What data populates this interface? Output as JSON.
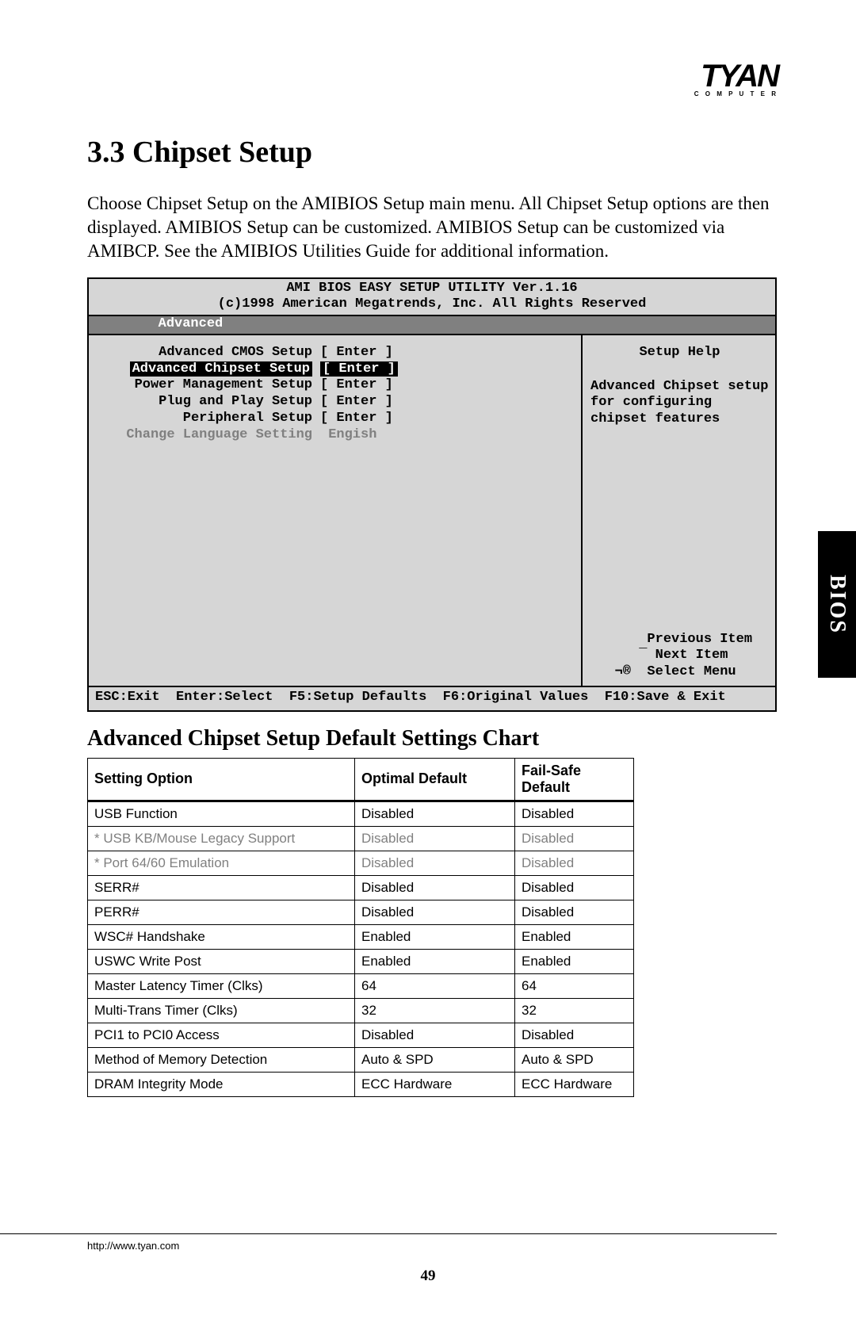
{
  "logo": {
    "brand": "TYAN",
    "subtitle": "C O M P U T E R"
  },
  "section": {
    "heading": "3.3 Chipset Setup",
    "intro": "Choose Chipset Setup on the AMIBIOS Setup main menu. All Chipset Setup options are then displayed. AMIBIOS Setup can be customized. AMIBIOS Setup can be customized via AMIBCP. See the AMIBIOS Utilities Guide for additional information."
  },
  "bios": {
    "title": "AMI BIOS EASY SETUP UTILITY Ver.1.16",
    "copyright": "(c)1998 American Megatrends, Inc.  All Rights Reserved",
    "tab": "Advanced",
    "menu": [
      {
        "label": "Advanced CMOS Setup",
        "value": "[ Enter ]",
        "highlight": false
      },
      {
        "label": "Advanced Chipset Setup",
        "value": "[ Enter ]",
        "highlight": true
      },
      {
        "label": "Power Management Setup",
        "value": "[ Enter ]",
        "highlight": false
      },
      {
        "label": "Plug and Play Setup",
        "value": "[ Enter ]",
        "highlight": false
      },
      {
        "label": "Peripheral Setup",
        "value": "[ Enter ]",
        "highlight": false
      },
      {
        "label": "Change Language Setting",
        "value": " Engish",
        "highlight": false,
        "muted": true
      }
    ],
    "help": {
      "title": "Setup Help",
      "text": "Advanced Chipset setup for configuring chipset features"
    },
    "navkeys": {
      "prev": "­ Previous Item",
      "next": "¯ Next Item",
      "select": "¬®  Select Menu"
    },
    "footer": "ESC:Exit  Enter:Select  F5:Setup Defaults  F6:Original Values  F10:Save & Exit"
  },
  "chart_heading": "Advanced Chipset Setup Default Settings Chart",
  "chart_data": {
    "type": "table",
    "title": "Advanced Chipset Setup Default Settings Chart",
    "columns": [
      "Setting Option",
      "Optimal Default",
      "Fail-Safe Default"
    ],
    "rows": [
      {
        "c0": "USB Function",
        "c1": "Disabled",
        "c2": "Disabled",
        "sub": false
      },
      {
        "c0": "* USB KB/Mouse Legacy Support",
        "c1": "Disabled",
        "c2": "Disabled",
        "sub": true
      },
      {
        "c0": "* Port 64/60 Emulation",
        "c1": "Disabled",
        "c2": "Disabled",
        "sub": true
      },
      {
        "c0": "SERR#",
        "c1": "Disabled",
        "c2": "Disabled",
        "sub": false
      },
      {
        "c0": "PERR#",
        "c1": "Disabled",
        "c2": "Disabled",
        "sub": false
      },
      {
        "c0": "WSC# Handshake",
        "c1": "Enabled",
        "c2": "Enabled",
        "sub": false
      },
      {
        "c0": "USWC Write Post",
        "c1": "Enabled",
        "c2": "Enabled",
        "sub": false
      },
      {
        "c0": "Master Latency Timer (Clks)",
        "c1": "64",
        "c2": "64",
        "sub": false
      },
      {
        "c0": "Multi-Trans Timer (Clks)",
        "c1": "32",
        "c2": "32",
        "sub": false
      },
      {
        "c0": "PCI1 to PCI0 Access",
        "c1": "Disabled",
        "c2": "Disabled",
        "sub": false
      },
      {
        "c0": "Method of Memory Detection",
        "c1": "Auto & SPD",
        "c2": "Auto & SPD",
        "sub": false
      },
      {
        "c0": "DRAM Integrity Mode",
        "c1": "ECC Hardware",
        "c2": "ECC Hardware",
        "sub": false
      }
    ]
  },
  "sidetab": "BIOS",
  "footer_url": "http://www.tyan.com",
  "page_number": "49"
}
